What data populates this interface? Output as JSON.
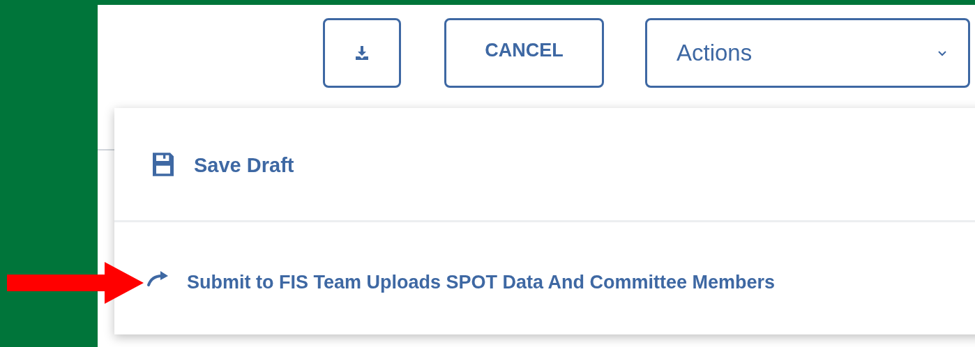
{
  "toolbar": {
    "cancel_label": "CANCEL",
    "actions_select": {
      "value": "Actions",
      "expanded": true
    }
  },
  "menu": {
    "items": [
      {
        "kind": "save",
        "label": "Save Draft"
      },
      {
        "kind": "redo",
        "label": "Submit to FIS Team Uploads SPOT Data And Committee Members"
      }
    ]
  }
}
